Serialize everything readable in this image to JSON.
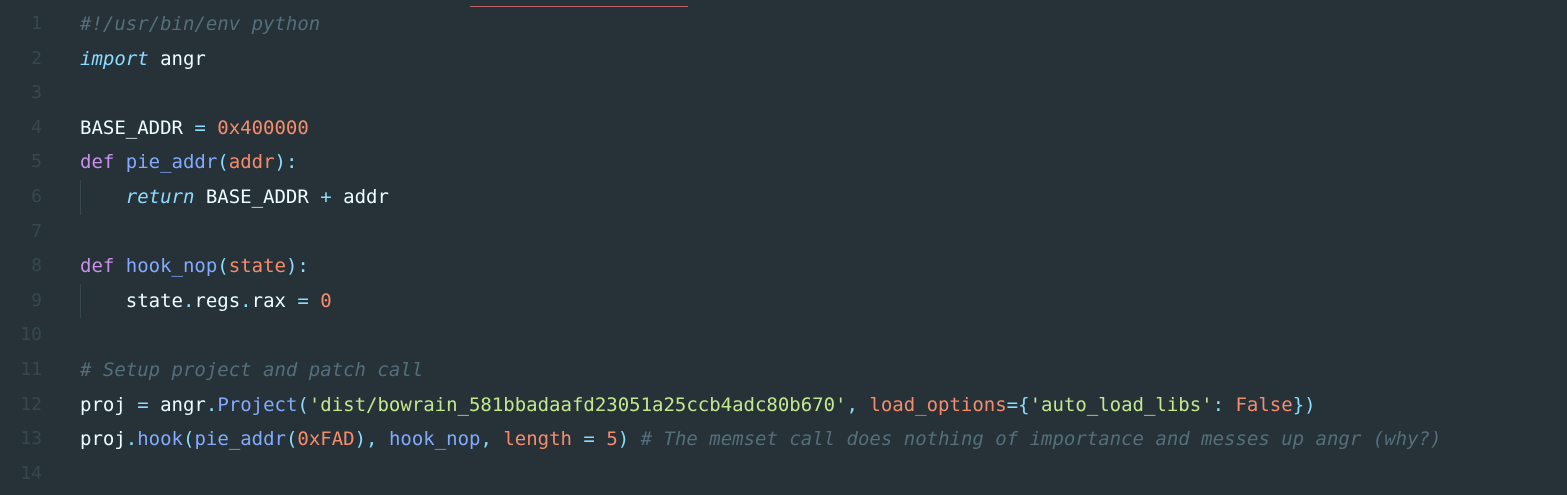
{
  "editor": {
    "language": "python",
    "colors": {
      "background": "#263238",
      "line_number": "#37474f",
      "text": "#eeffff",
      "comment": "#546e7a",
      "keyword": "#c792ea",
      "function": "#82aaff",
      "number": "#f78c6c",
      "operator": "#89ddff",
      "string": "#c3e88d"
    },
    "lines": [
      {
        "n": "1",
        "tokens": [
          {
            "t": "#!/usr/bin/env python",
            "k": "cm"
          }
        ]
      },
      {
        "n": "2",
        "tokens": [
          {
            "t": "import",
            "k": "kw it"
          },
          {
            "t": " angr",
            "k": ""
          }
        ]
      },
      {
        "n": "3",
        "tokens": []
      },
      {
        "n": "4",
        "tokens": [
          {
            "t": "BASE_ADDR ",
            "k": ""
          },
          {
            "t": "=",
            "k": "op"
          },
          {
            "t": " ",
            "k": ""
          },
          {
            "t": "0x400000",
            "k": "nu"
          }
        ]
      },
      {
        "n": "5",
        "tokens": [
          {
            "t": "def",
            "k": "kw"
          },
          {
            "t": " ",
            "k": ""
          },
          {
            "t": "pie_addr",
            "k": "fn"
          },
          {
            "t": "(",
            "k": "op"
          },
          {
            "t": "addr",
            "k": "pm"
          },
          {
            "t": "):",
            "k": "op"
          }
        ]
      },
      {
        "n": "6",
        "guide": true,
        "tokens": [
          {
            "t": "    ",
            "k": ""
          },
          {
            "t": "return",
            "k": "kw it"
          },
          {
            "t": " BASE_ADDR ",
            "k": ""
          },
          {
            "t": "+",
            "k": "op"
          },
          {
            "t": " addr",
            "k": ""
          }
        ]
      },
      {
        "n": "7",
        "tokens": []
      },
      {
        "n": "8",
        "tokens": [
          {
            "t": "def",
            "k": "kw"
          },
          {
            "t": " ",
            "k": ""
          },
          {
            "t": "hook_nop",
            "k": "fn"
          },
          {
            "t": "(",
            "k": "op"
          },
          {
            "t": "state",
            "k": "pm"
          },
          {
            "t": "):",
            "k": "op"
          }
        ]
      },
      {
        "n": "9",
        "guide": true,
        "tokens": [
          {
            "t": "    state",
            "k": ""
          },
          {
            "t": ".",
            "k": "op"
          },
          {
            "t": "regs",
            "k": ""
          },
          {
            "t": ".",
            "k": "op"
          },
          {
            "t": "rax ",
            "k": ""
          },
          {
            "t": "=",
            "k": "op"
          },
          {
            "t": " ",
            "k": ""
          },
          {
            "t": "0",
            "k": "nu"
          }
        ]
      },
      {
        "n": "10",
        "tokens": []
      },
      {
        "n": "11",
        "tokens": [
          {
            "t": "# Setup project and patch call",
            "k": "cm"
          }
        ]
      },
      {
        "n": "12",
        "tokens": [
          {
            "t": "proj ",
            "k": ""
          },
          {
            "t": "=",
            "k": "op"
          },
          {
            "t": " angr",
            "k": ""
          },
          {
            "t": ".",
            "k": "op"
          },
          {
            "t": "Project",
            "k": "fn"
          },
          {
            "t": "(",
            "k": "op"
          },
          {
            "t": "'dist/bowrain_581bbadaafd23051a25ccb4adc80b670'",
            "k": "st"
          },
          {
            "t": ", ",
            "k": "op"
          },
          {
            "t": "load_options",
            "k": "pm"
          },
          {
            "t": "=",
            "k": "op"
          },
          {
            "t": "{",
            "k": "op"
          },
          {
            "t": "'auto_load_libs'",
            "k": "st"
          },
          {
            "t": ": ",
            "k": "op"
          },
          {
            "t": "False",
            "k": "cn"
          },
          {
            "t": "})",
            "k": "op"
          }
        ]
      },
      {
        "n": "13",
        "tokens": [
          {
            "t": "proj",
            "k": ""
          },
          {
            "t": ".",
            "k": "op"
          },
          {
            "t": "hook",
            "k": "fn"
          },
          {
            "t": "(",
            "k": "op"
          },
          {
            "t": "pie_addr",
            "k": "fn"
          },
          {
            "t": "(",
            "k": "op"
          },
          {
            "t": "0xFAD",
            "k": "nu"
          },
          {
            "t": "), ",
            "k": "op"
          },
          {
            "t": "hook_nop",
            "k": "fn"
          },
          {
            "t": ", ",
            "k": "op"
          },
          {
            "t": "length",
            "k": "pm"
          },
          {
            "t": " = ",
            "k": "op"
          },
          {
            "t": "5",
            "k": "nu"
          },
          {
            "t": ") ",
            "k": "op"
          },
          {
            "t": "# The memset call does nothing of importance and messes up angr (why?)",
            "k": "cm"
          }
        ]
      },
      {
        "n": "14",
        "tokens": []
      }
    ]
  }
}
